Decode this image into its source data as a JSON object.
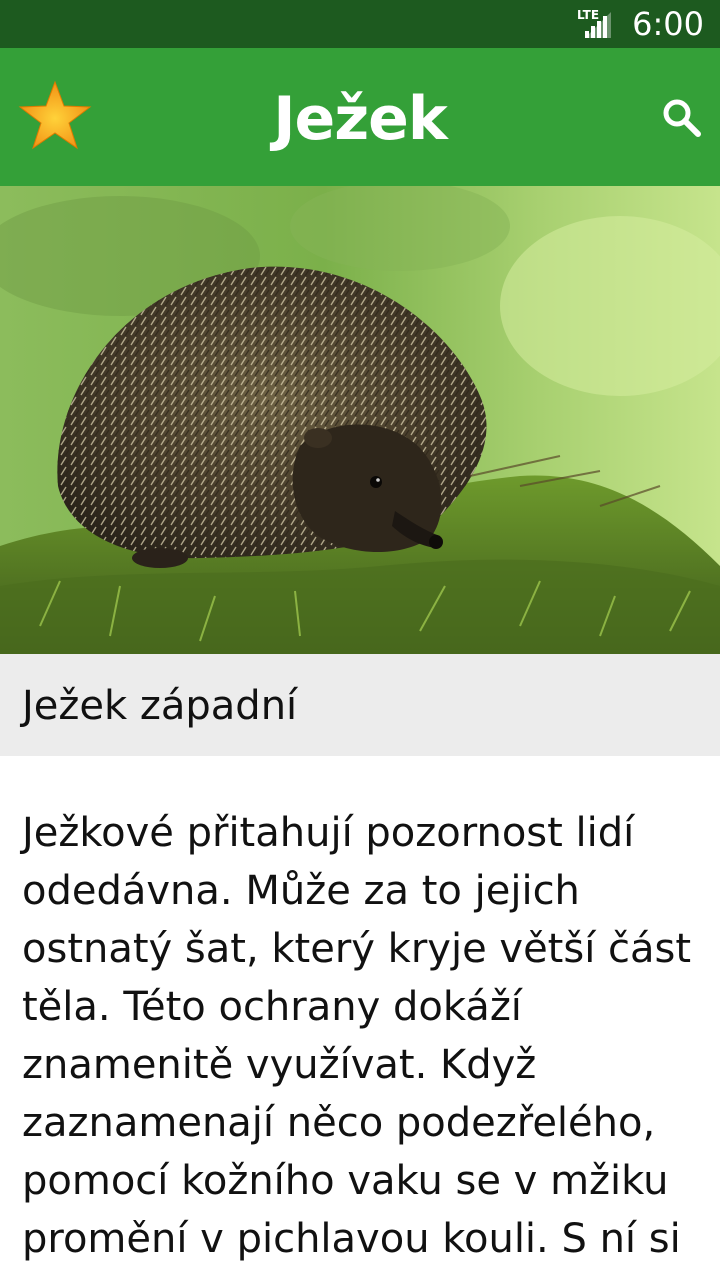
{
  "status_bar": {
    "network": "LTE",
    "time": "6:00"
  },
  "app_bar": {
    "title": "Ježek",
    "favorite_icon": "star-icon",
    "search_icon": "search-icon",
    "colors": {
      "background": "#34a038",
      "status_bar": "#1d5a1f",
      "star": "#f7a823"
    }
  },
  "hero": {
    "image": "hedgehog-photo"
  },
  "subtitle": "Ježek západní",
  "article": {
    "text": "Ježkové přitahují pozornost lidí odedávna. Může za to jejich ostnatý šat, který kryje větší část těla. Této ochrany dokáží znamenitě využívat. Když zaznamenají něco podezřelého, pomocí kožního vaku se v mžiku promění v pichlavou kouli. S ní si"
  }
}
